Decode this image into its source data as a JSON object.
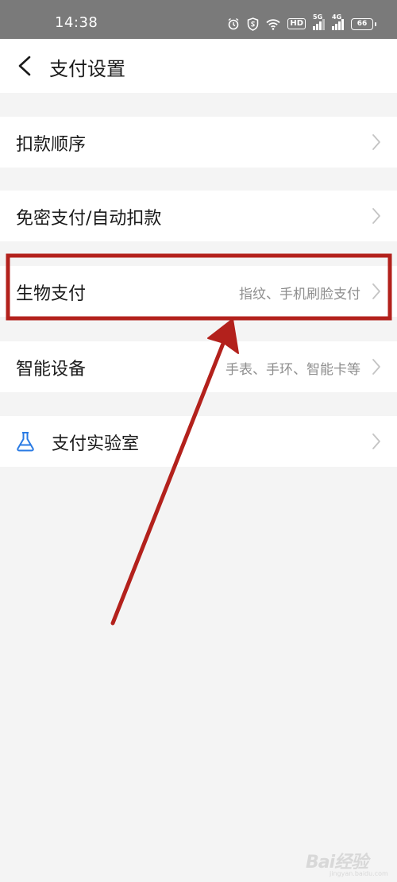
{
  "status_bar": {
    "time": "14:38",
    "network_5g": "5G",
    "network_4g": "4G",
    "hd": "HD",
    "battery": "66"
  },
  "nav": {
    "title": "支付设置"
  },
  "rows": [
    {
      "label": "扣款顺序",
      "sub": ""
    },
    {
      "label": "免密支付/自动扣款",
      "sub": ""
    },
    {
      "label": "生物支付",
      "sub": "指纹、手机刷脸支付"
    },
    {
      "label": "智能设备",
      "sub": "手表、手环、智能卡等"
    },
    {
      "label": "支付实验室",
      "sub": ""
    }
  ],
  "watermark": {
    "text": "Bai经验",
    "sub": "jingyan.baidu.com"
  },
  "colors": {
    "status_bar": "#7a7a7a",
    "background": "#f4f4f4",
    "annotation": "#b3211c",
    "lab_icon": "#2a7be4"
  }
}
